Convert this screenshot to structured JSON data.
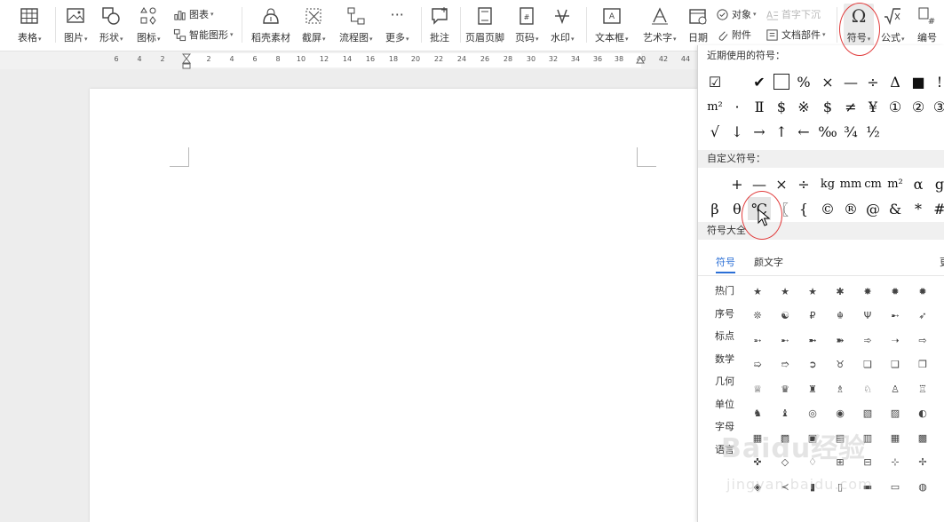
{
  "toolbar": {
    "table": "表格",
    "picture": "图片",
    "shape": "形状",
    "icon": "图标",
    "chart": "图表",
    "smart_shape": "智能图形",
    "material": "稻壳素材",
    "screenshot": "截屏",
    "flowchart": "流程图",
    "more": "更多",
    "comment": "批注",
    "header_footer": "页眉页脚",
    "page_number": "页码",
    "watermark": "水印",
    "textbox": "文本框",
    "wordart": "艺术字",
    "date": "日期",
    "object": "对象",
    "drop_cap": "首字下沉",
    "attachment": "附件",
    "doc_parts": "文档部件",
    "symbol": "符号",
    "formula": "公式",
    "numbering": "编号"
  },
  "ruler": {
    "ticks": [
      "6",
      "4",
      "2",
      "2",
      "4",
      "6",
      "8",
      "10",
      "12",
      "14",
      "16",
      "18",
      "20",
      "22",
      "24",
      "26",
      "28",
      "30",
      "32",
      "34",
      "36",
      "38",
      "40",
      "42",
      "44"
    ]
  },
  "panel": {
    "recent_title": "近期使用的符号：",
    "custom_title": "自定义符号：",
    "all_title": "符号大全",
    "recent": [
      [
        "☑",
        "",
        "✔",
        "□",
        "%",
        "×",
        "—",
        "÷",
        "Δ",
        "■",
        "!"
      ],
      [
        "m²",
        "·",
        "Ⅱ",
        "$",
        "※",
        "$",
        "≠",
        "¥",
        "①",
        "②",
        "③"
      ],
      [
        "√",
        "↓",
        "→",
        "↑",
        "←",
        "‰",
        "¾",
        "½"
      ]
    ],
    "custom": [
      [
        "",
        "+",
        "—",
        "×",
        "÷",
        "kg",
        "mm",
        "cm",
        "m²",
        "α",
        "g"
      ],
      [
        "β",
        "θ",
        "℃",
        "〖",
        "{",
        "©",
        "®",
        "@",
        "&",
        "*",
        "#"
      ]
    ],
    "tabs": [
      "符号",
      "颜文字",
      "更"
    ],
    "categories": [
      "热门",
      "序号",
      "标点",
      "数学",
      "几何",
      "单位",
      "字母",
      "语言"
    ],
    "grid": [
      [
        "★",
        "★",
        "★",
        "✱",
        "✸",
        "✹",
        "✹"
      ],
      [
        "❊",
        "☯",
        "₽",
        "☬",
        "Ψ",
        "➸",
        "➶"
      ],
      [
        "➵",
        "➸",
        "➼",
        "➽",
        "➾",
        "➝",
        "⇨"
      ],
      [
        "➯",
        "➱",
        "➲",
        "♉",
        "❏",
        "❑",
        "❒"
      ],
      [
        "♕",
        "♛",
        "♜",
        "♗",
        "♘",
        "♙",
        "♖"
      ],
      [
        "♞",
        "♝",
        "◎",
        "◉",
        "▧",
        "▨",
        "◐"
      ],
      [
        "▦",
        "▩",
        "▣",
        "▤",
        "▥",
        "▦",
        "▩"
      ],
      [
        "✜",
        "◇",
        "♢",
        "⊞",
        "⊟",
        "⊹",
        "✢"
      ],
      [
        "◈",
        "≺",
        "▮",
        "▯",
        "▬",
        "▭",
        "◍"
      ]
    ]
  },
  "watermark": {
    "text": "Baidu经验",
    "url": "jingyan.baidu.com"
  },
  "colors": {
    "accent_blue": "#2b6fd6",
    "annotation_red": "#e13c3c"
  }
}
